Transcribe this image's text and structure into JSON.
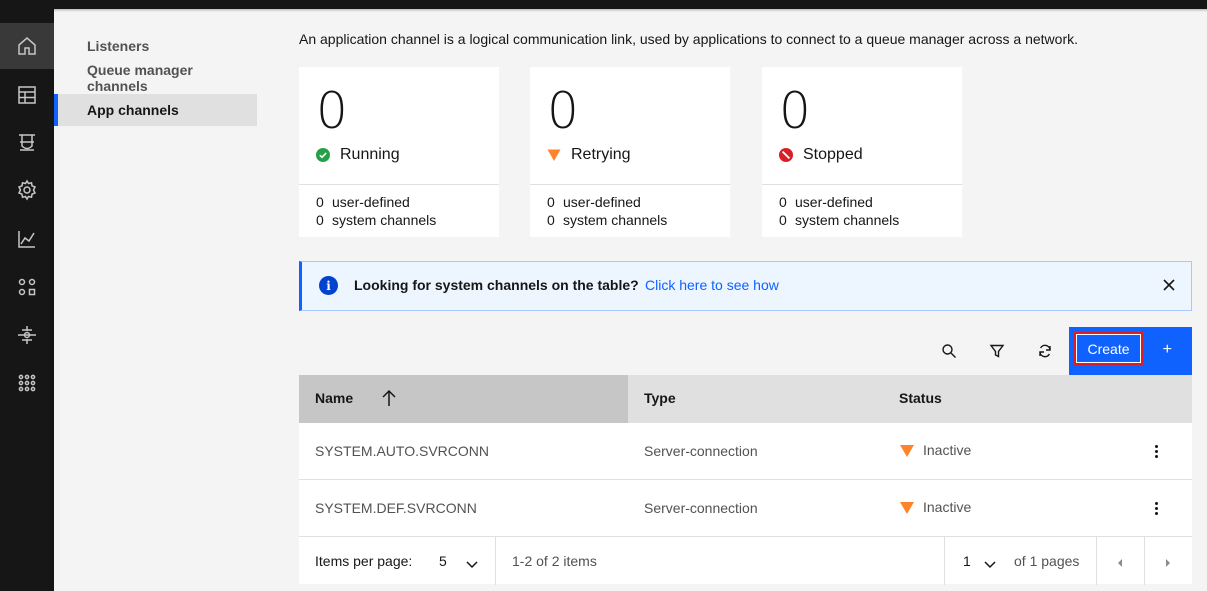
{
  "rail": {
    "items": [
      {
        "icon": "home-icon"
      },
      {
        "icon": "table-icon"
      },
      {
        "icon": "gateway-icon"
      },
      {
        "icon": "settings-icon"
      },
      {
        "icon": "chart-line-icon"
      },
      {
        "icon": "apps-icon"
      },
      {
        "icon": "sliders-icon"
      },
      {
        "icon": "network-icon"
      }
    ]
  },
  "sidenav": {
    "items": [
      {
        "label": "Listeners"
      },
      {
        "label": "Queue manager channels"
      },
      {
        "label": "App channels"
      }
    ]
  },
  "description": "An application channel is a logical communication link, used by applications to connect to a queue manager across a network.",
  "tiles": [
    {
      "count": "0",
      "status": "Running",
      "user_defined_count": "0",
      "user_defined_label": "user-defined",
      "system_count": "0",
      "system_label": "system channels",
      "icon": "checkmark-filled-icon",
      "color": "#24a148"
    },
    {
      "count": "0",
      "status": "Retrying",
      "user_defined_count": "0",
      "user_defined_label": "user-defined",
      "system_count": "0",
      "system_label": "system channels",
      "icon": "warning-triangle-icon",
      "color": "#ff832b"
    },
    {
      "count": "0",
      "status": "Stopped",
      "user_defined_count": "0",
      "user_defined_label": "user-defined",
      "system_count": "0",
      "system_label": "system channels",
      "icon": "error-filled-icon",
      "color": "#da1e28"
    }
  ],
  "notification": {
    "title": "Looking for system channels on the table?",
    "link": "Click here to see how",
    "info_glyph": "i"
  },
  "toolbar": {
    "create_label": "Create",
    "create_plus": "+"
  },
  "table": {
    "headers": {
      "name": "Name",
      "type": "Type",
      "status": "Status"
    },
    "rows": [
      {
        "name": "SYSTEM.AUTO.SVRCONN",
        "type": "Server-connection",
        "status": "Inactive"
      },
      {
        "name": "SYSTEM.DEF.SVRCONN",
        "type": "Server-connection",
        "status": "Inactive"
      }
    ]
  },
  "pagination": {
    "items_per_page_label": "Items per page:",
    "items_per_page": "5",
    "range": "1-2 of 2 items",
    "page": "1",
    "of_pages": "of 1 pages"
  },
  "colors": {
    "accent": "#0f62fe",
    "warning": "#ff832b",
    "success": "#24a148",
    "error": "#da1e28"
  }
}
